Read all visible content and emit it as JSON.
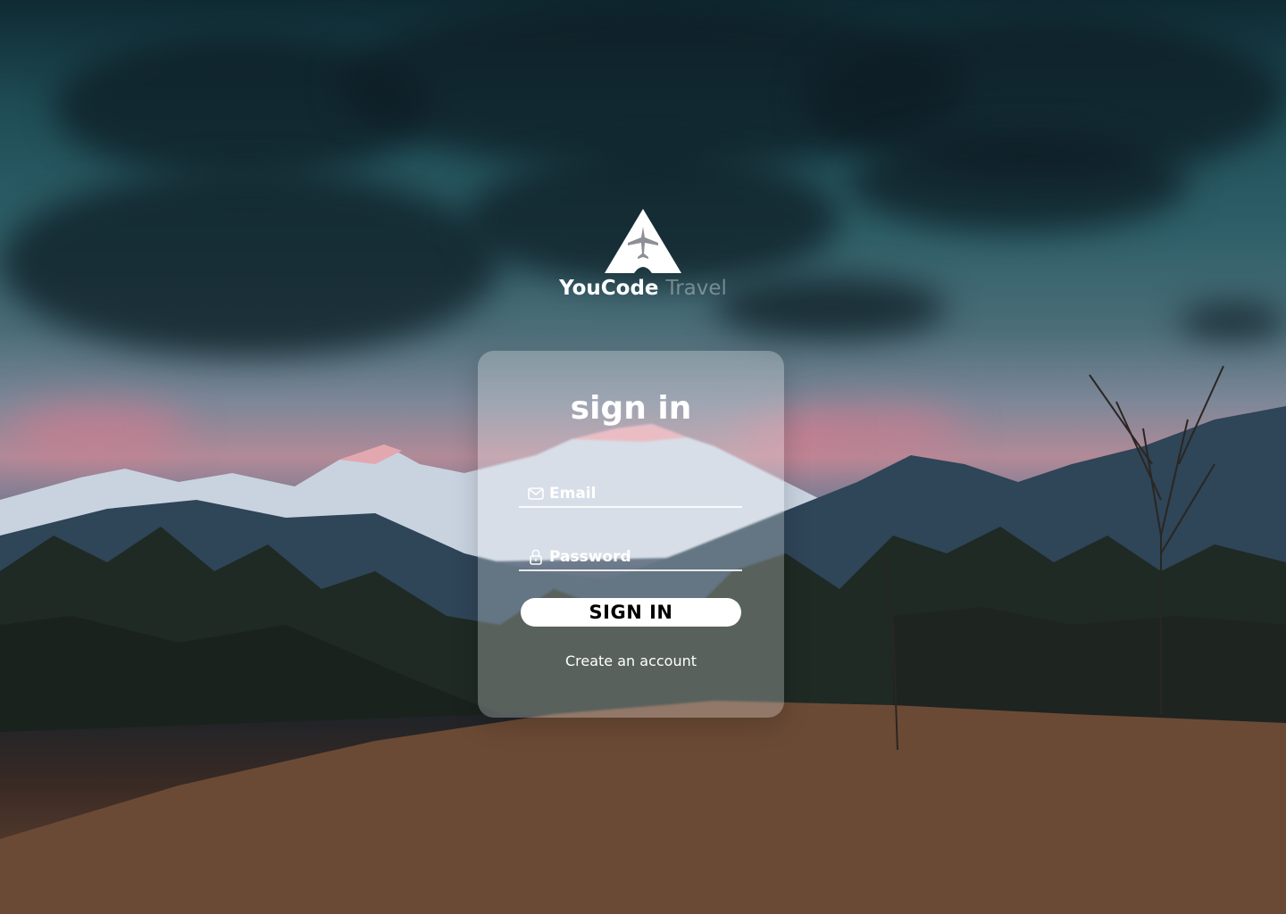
{
  "brand": {
    "name_primary": "YouCode",
    "name_secondary": "Travel",
    "logo_icon": "airplane-triangle-icon"
  },
  "form": {
    "title": "sign in",
    "email": {
      "placeholder": "Email",
      "value": "",
      "icon": "envelope-icon"
    },
    "password": {
      "placeholder": "Password",
      "value": "",
      "icon": "lock-icon"
    },
    "submit_label": "SIGN IN",
    "create_account_label": "Create an account"
  },
  "colors": {
    "card_bg": "rgba(255,255,255,0.26)",
    "button_bg": "#ffffff",
    "text": "#ffffff"
  }
}
